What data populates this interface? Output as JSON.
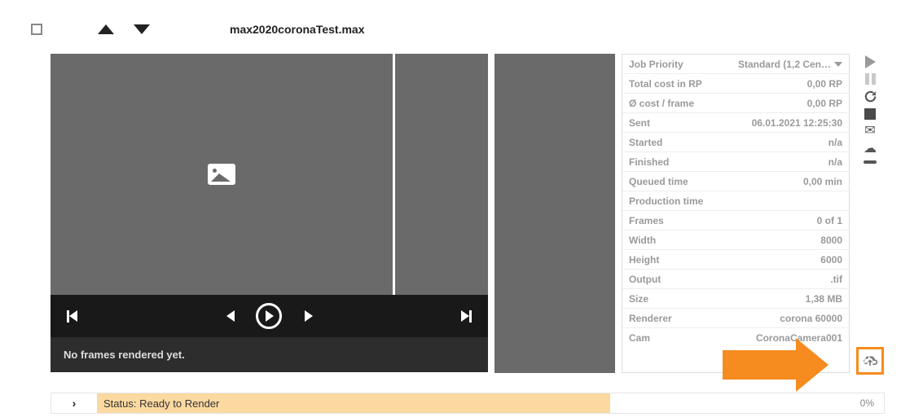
{
  "header": {
    "file_name": "max2020coronaTest.max"
  },
  "player": {
    "message": "No frames rendered yet."
  },
  "details": [
    {
      "label": "Job Priority",
      "value": "Standard (1,2 Cen…",
      "dropdown": true
    },
    {
      "label": "Total cost in RP",
      "value": "0,00 RP"
    },
    {
      "label": "Ø cost / frame",
      "value": "0,00 RP"
    },
    {
      "label": "Sent",
      "value": "06.01.2021 12:25:30"
    },
    {
      "label": "Started",
      "value": "n/a"
    },
    {
      "label": "Finished",
      "value": "n/a"
    },
    {
      "label": "Queued time",
      "value": "0,00 min"
    },
    {
      "label": "Production time",
      "value": ""
    },
    {
      "label": "Frames",
      "value": "0 of 1"
    },
    {
      "label": "Width",
      "value": "8000"
    },
    {
      "label": "Height",
      "value": "6000"
    },
    {
      "label": "Output",
      "value": ".tif"
    },
    {
      "label": "Size",
      "value": "1,38 MB"
    },
    {
      "label": "Renderer",
      "value": "corona 60000"
    },
    {
      "label": "Cam",
      "value": "CoronaCamera001"
    }
  ],
  "status": {
    "label": "Status: Ready to Render",
    "progress": "0%"
  }
}
